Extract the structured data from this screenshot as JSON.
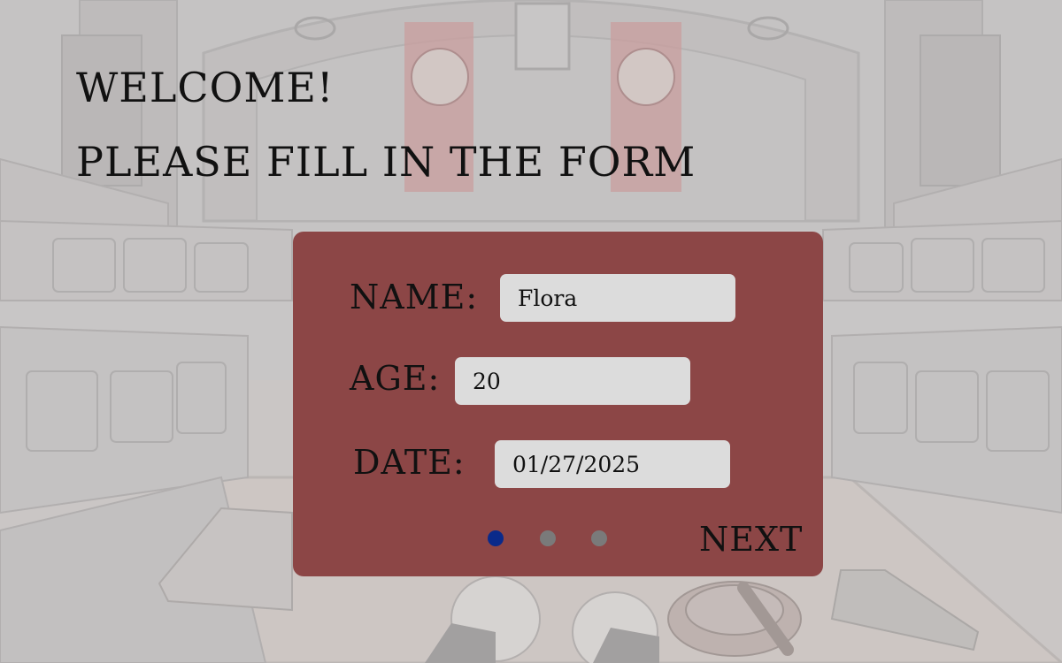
{
  "header": {
    "welcome": "WELCOME!",
    "subtitle": "PLEASE FILL IN THE FORM"
  },
  "form": {
    "name_label": "NAME:",
    "name_value": "Flora",
    "age_label": "AGE:",
    "age_value": "20",
    "date_label": "DATE:",
    "date_value": "01/27/2025",
    "next_label": "NEXT"
  },
  "pagination": {
    "current_page": 1,
    "total_pages": 3
  },
  "colors": {
    "panel": "#8c4646",
    "input_bg": "#dcdcdc",
    "dot_active": "#0a2a8a",
    "dot_inactive": "#7a7a7a",
    "text": "#111111",
    "banner": "#c98a8a"
  }
}
